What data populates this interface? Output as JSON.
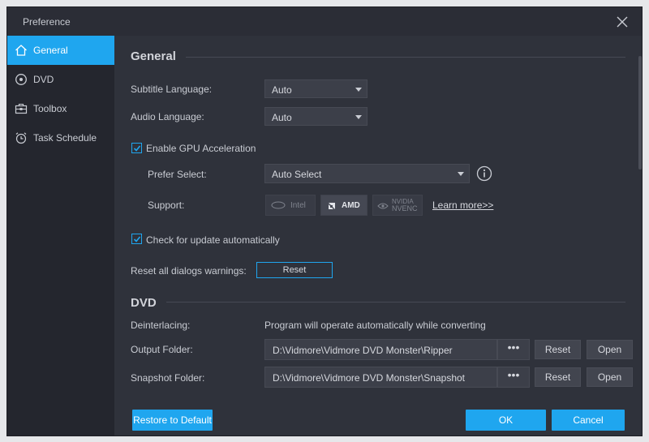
{
  "window": {
    "title": "Preference"
  },
  "sidebar": {
    "items": [
      {
        "label": "General",
        "icon": "home-icon",
        "active": true
      },
      {
        "label": "DVD",
        "icon": "disc-icon",
        "active": false
      },
      {
        "label": "Toolbox",
        "icon": "toolbox-icon",
        "active": false
      },
      {
        "label": "Task Schedule",
        "icon": "alarm-clock-icon",
        "active": false
      }
    ]
  },
  "general": {
    "title": "General",
    "subtitle_language": {
      "label": "Subtitle Language:",
      "value": "Auto"
    },
    "audio_language": {
      "label": "Audio Language:",
      "value": "Auto"
    },
    "gpu": {
      "label": "Enable GPU Acceleration",
      "checked": true,
      "prefer_label": "Prefer Select:",
      "prefer_value": "Auto Select",
      "support_label": "Support:",
      "supports": [
        {
          "name": "Intel",
          "active": false
        },
        {
          "name": "AMD",
          "active": true
        },
        {
          "name": "NVIDIA NVENC",
          "line1": "NVIDIA",
          "line2": "NVENC",
          "active": false
        }
      ],
      "learn_more": "Learn more>>"
    },
    "update": {
      "label": "Check for update automatically",
      "checked": true
    },
    "reset_dialogs": {
      "label": "Reset all dialogs warnings:",
      "button": "Reset"
    }
  },
  "dvd": {
    "title": "DVD",
    "deinterlacing": {
      "label": "Deinterlacing:",
      "value": "Program will operate automatically while converting"
    },
    "output_folder": {
      "label": "Output Folder:",
      "value": "D:\\Vidmore\\Vidmore DVD Monster\\Ripper",
      "browse": "•••",
      "reset": "Reset",
      "open": "Open"
    },
    "snapshot_folder": {
      "label": "Snapshot Folder:",
      "value": "D:\\Vidmore\\Vidmore DVD Monster\\Snapshot",
      "browse": "•••",
      "reset": "Reset",
      "open": "Open"
    }
  },
  "footer": {
    "restore": "Restore to Default",
    "ok": "OK",
    "cancel": "Cancel"
  },
  "colors": {
    "accent": "#1fa6ef",
    "bg": "#2f323b",
    "sidebar": "#24262e"
  }
}
